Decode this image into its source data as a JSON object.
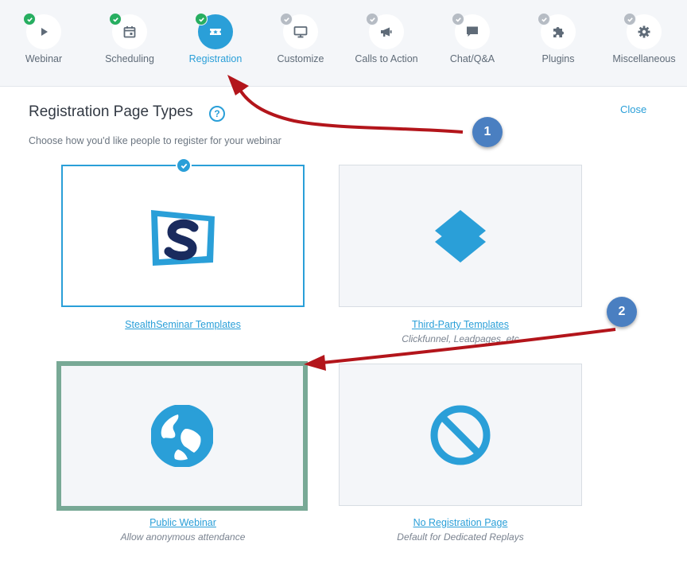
{
  "steps": [
    {
      "label": "Webinar",
      "icon": "play-icon",
      "status": "done"
    },
    {
      "label": "Scheduling",
      "icon": "calendar-icon",
      "status": "done"
    },
    {
      "label": "Registration",
      "icon": "ticket-icon",
      "status": "active"
    },
    {
      "label": "Customize",
      "icon": "monitor-icon",
      "status": "pending"
    },
    {
      "label": "Calls to Action",
      "icon": "megaphone-icon",
      "status": "pending"
    },
    {
      "label": "Chat/Q&A",
      "icon": "chat-bubble-icon",
      "status": "pending"
    },
    {
      "label": "Plugins",
      "icon": "puzzle-icon",
      "status": "pending"
    },
    {
      "label": "Miscellaneous",
      "icon": "gear-icon",
      "status": "pending"
    }
  ],
  "page": {
    "title": "Registration Page Types",
    "help_glyph": "?",
    "close_label": "Close",
    "subtitle": "Choose how you'd like people to register for your webinar"
  },
  "options": [
    {
      "label": "StealthSeminar Templates",
      "sub": "",
      "icon": "stealthseminar-logo-icon",
      "selected": true
    },
    {
      "label": "Third-Party Templates",
      "sub": "Clickfunnel, Leadpages, etc",
      "icon": "layers-icon",
      "selected": false
    },
    {
      "label": "Public Webinar",
      "sub": "Allow anonymous attendance",
      "icon": "globe-icon",
      "selected": false
    },
    {
      "label": "No Registration Page",
      "sub": "Default for Dedicated Replays",
      "icon": "prohibited-icon",
      "selected": false
    }
  ],
  "callouts": [
    "1",
    "2"
  ],
  "colors": {
    "accent": "#2a9fd8",
    "done": "#27ae60",
    "pending": "#b6bcc4",
    "annotation_arrow": "#b3151b",
    "annotation_highlight": "#78a996",
    "callout": "#4a7fc1"
  }
}
